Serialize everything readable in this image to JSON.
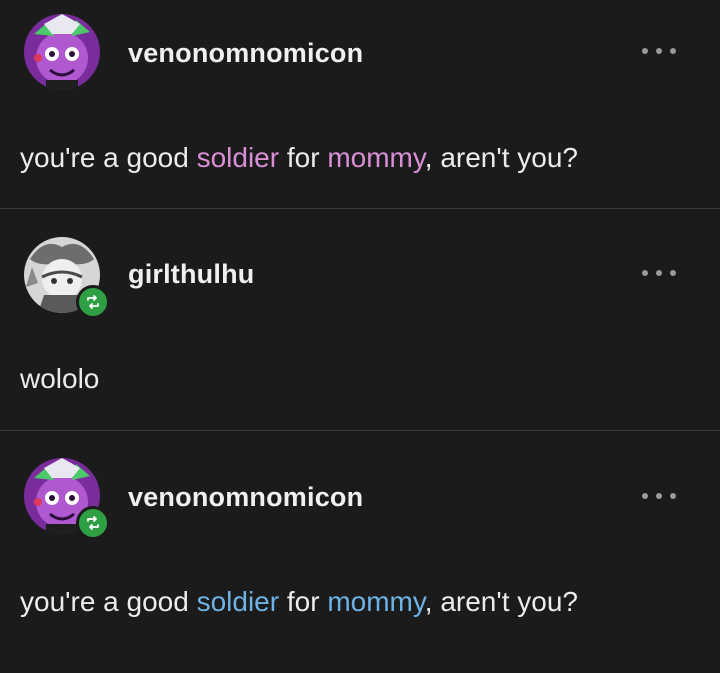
{
  "posts": [
    {
      "username": "venonomnomicon",
      "text_before": "you're a good ",
      "highlight_1": "soldier",
      "text_middle": " for ",
      "highlight_2": "mommy",
      "text_after": ", aren't you?",
      "highlight_color": "#d98fd6",
      "avatar_icon": "clown-avatar-icon",
      "reblogged": false
    },
    {
      "username": "girlthulhu",
      "text": "wololo",
      "avatar_icon": "grey-character-avatar-icon",
      "reblogged": true
    },
    {
      "username": "venonomnomicon",
      "text_before": "you're a good ",
      "highlight_1": "soldier",
      "text_middle": " for ",
      "highlight_2": "mommy",
      "text_after": ", aren't you?",
      "highlight_color": "#6eb3e6",
      "avatar_icon": "clown-avatar-icon",
      "reblogged": true
    }
  ],
  "colors": {
    "background": "#1b1b1b",
    "divider": "#3a3a3a",
    "reblog_badge": "#2ea043",
    "text": "#ececec"
  },
  "icons": {
    "more": "more-options-icon",
    "reblog": "reblog-icon"
  }
}
